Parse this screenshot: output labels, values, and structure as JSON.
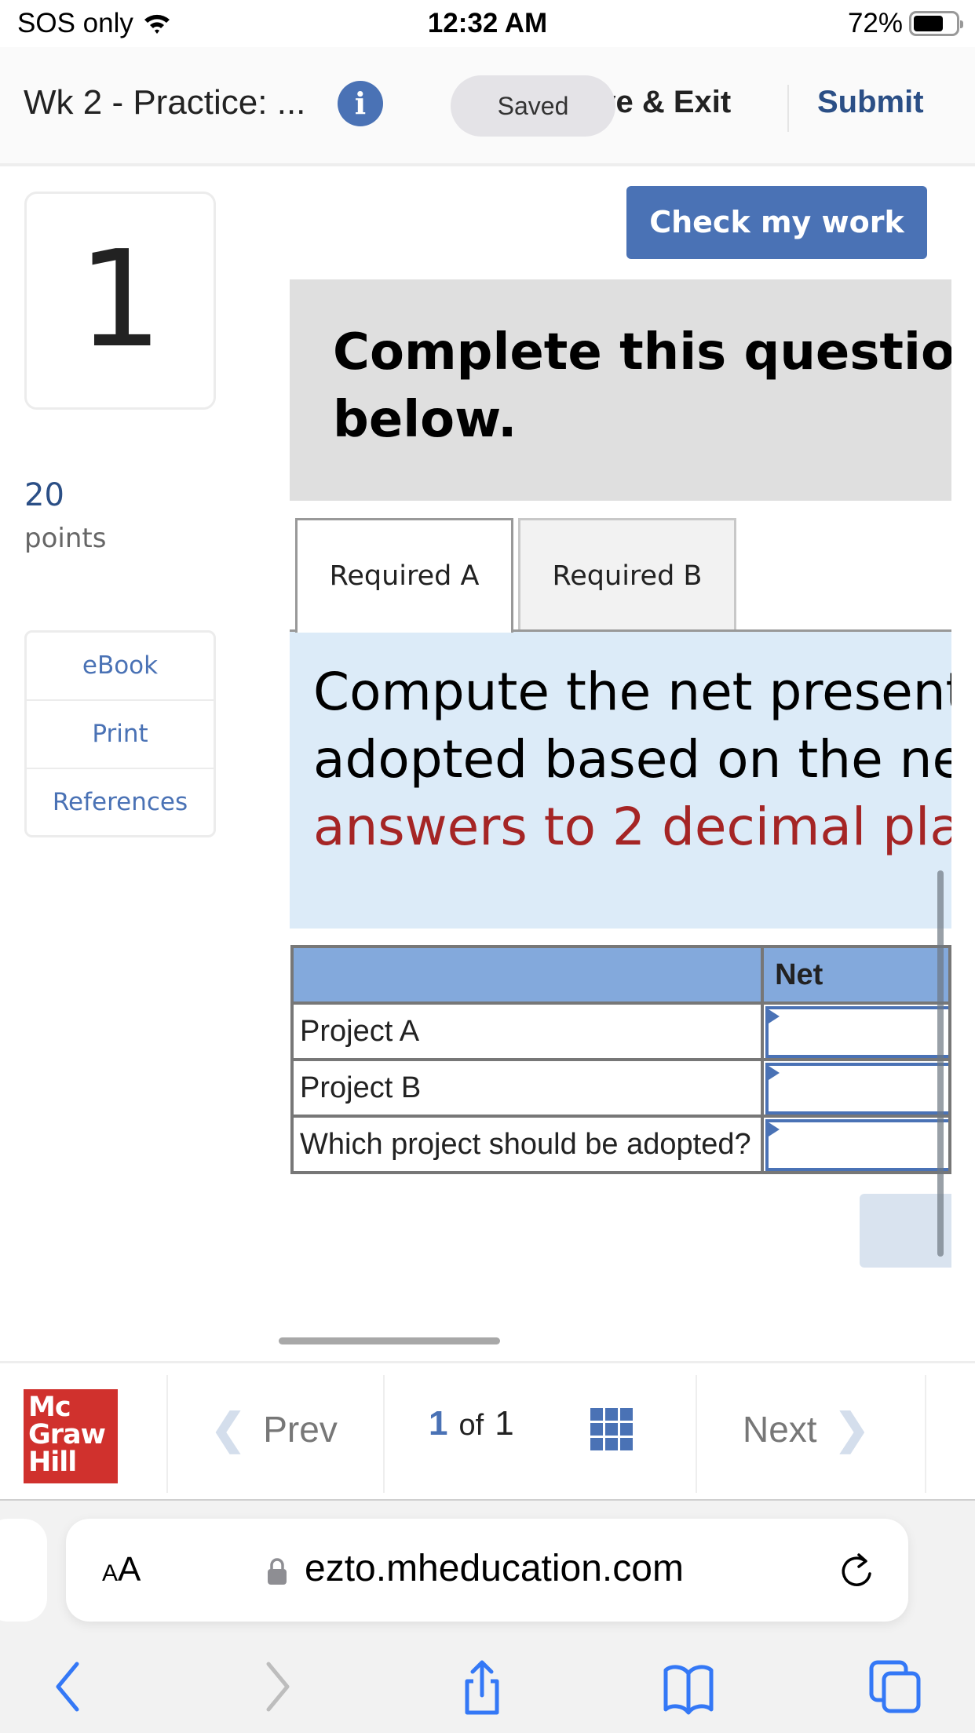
{
  "status_bar": {
    "carrier": "SOS only",
    "time": "12:32 AM",
    "battery": "72%",
    "battery_level": 0.72
  },
  "header": {
    "title": "Wk 2 - Practice: ...",
    "saved_badge": "Saved",
    "save_exit": "ave & Exit",
    "submit": "Submit"
  },
  "sidebar": {
    "question_number": "1",
    "points_value": "20",
    "points_label": "points",
    "links": [
      {
        "label": "eBook"
      },
      {
        "label": "Print"
      },
      {
        "label": "References"
      }
    ]
  },
  "main": {
    "check_button": "Check my work",
    "title_line1": "Complete this questio",
    "title_line2": "below.",
    "tabs": [
      {
        "label": "Required A",
        "active": true
      },
      {
        "label": "Required B",
        "active": false
      }
    ],
    "question_line1": "Compute the net present",
    "question_line2": "adopted based on the ne",
    "question_line3": "answers to 2 decimal pla",
    "table": {
      "headers": [
        "",
        "Net"
      ],
      "rows": [
        {
          "label": "Project A",
          "value": ""
        },
        {
          "label": "Project B",
          "value": ""
        },
        {
          "label": "Which project should be adopted?",
          "value": ""
        }
      ]
    }
  },
  "bottom_nav": {
    "logo_lines": [
      "Mc",
      "Graw",
      "Hill"
    ],
    "prev": "Prev",
    "page_current": "1",
    "page_of": "of",
    "page_total": "1",
    "next": "Next"
  },
  "browser": {
    "aa_small": "A",
    "aa_large": "A",
    "url": "ezto.mheducation.com"
  },
  "colors": {
    "accent_blue": "#4a72b5",
    "submit_navy": "#2b4f86",
    "instruction_red": "#a52525",
    "table_header": "#83a9dc",
    "question_panel": "#dcebf8",
    "brand_red": "#d0312d"
  }
}
